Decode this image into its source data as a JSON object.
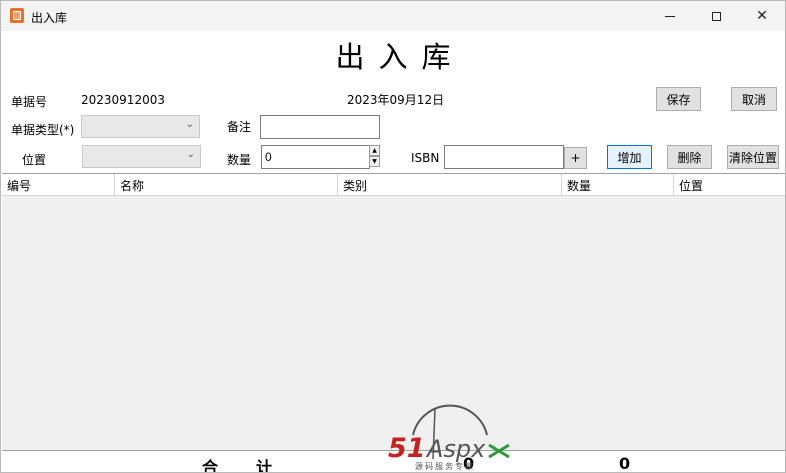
{
  "window": {
    "title": "出入库",
    "minimize_label": "—",
    "close_label": "✕"
  },
  "heading": "出入库",
  "form": {
    "order_no_label": "单据号",
    "order_no_value": "20230912003",
    "date_value": "2023年09月12日",
    "type_label": "单据类型(*)",
    "type_value": "",
    "remark_label": "备注",
    "remark_value": "",
    "location_label": "位置",
    "location_value": "",
    "quantity_label": "数量",
    "quantity_value": "0",
    "isbn_label": "ISBN",
    "isbn_value": "",
    "isbn_add_label": "+"
  },
  "buttons": {
    "save": "保存",
    "cancel": "取消",
    "add": "增加",
    "delete": "删除",
    "clear_location": "清除位置"
  },
  "grid": {
    "columns": [
      "编号",
      "名称",
      "类别",
      "数量",
      "位置"
    ],
    "rows": []
  },
  "totals": {
    "label_1": "合",
    "label_2": "计",
    "count_value": "0",
    "quantity_value": "0"
  },
  "watermark": {
    "brand_51": "51",
    "brand_aspx": "Aspx",
    "tagline": "源码服务专家",
    "colors": {
      "red": "#c8201e",
      "gray": "#555555",
      "green": "#2e9a3a"
    }
  }
}
